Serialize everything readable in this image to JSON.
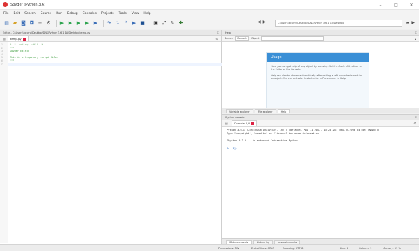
{
  "window": {
    "title": "Spyder (Python 3.6)",
    "controls": {
      "minimize": "–",
      "maximize": "□",
      "close": "✕"
    }
  },
  "menu": [
    "File",
    "Edit",
    "Search",
    "Source",
    "Run",
    "Debug",
    "Consoles",
    "Projects",
    "Tools",
    "View",
    "Help"
  ],
  "toolbar": {
    "path": "C:\\Users\\bcurry\\Desktop\\DNXPython 3.6.1 1A\\Desktop",
    "icons": [
      "new-file",
      "open",
      "save",
      "save-all",
      "files",
      "preferences",
      "run",
      "run-cell",
      "run-cell-advance",
      "run-selection",
      "debug",
      "step",
      "step-into",
      "step-return",
      "continue",
      "stop",
      "maximize-pane",
      "python-path",
      "back",
      "forward"
    ]
  },
  "editor": {
    "title": "Editor - C:\\Users\\bcurry\\Desktop\\DNXPython 3.6.1 1A\\Desktop\\temp.py",
    "tab_label": "temp.py",
    "lines": [
      {
        "n": "1",
        "text": "# -*- coding: utf-8 -*-",
        "kind": "com"
      },
      {
        "n": "2",
        "text": "\"\"\"",
        "kind": "str"
      },
      {
        "n": "3",
        "text": "Spyder Editor",
        "kind": "str"
      },
      {
        "n": "4",
        "text": "",
        "kind": "str"
      },
      {
        "n": "5",
        "text": "This is a temporary script file.",
        "kind": "str"
      },
      {
        "n": "6",
        "text": "\"\"\"",
        "kind": "str"
      },
      {
        "n": "7",
        "text": "",
        "kind": "act"
      }
    ]
  },
  "help": {
    "title": "Help",
    "source_label": "Source",
    "source_value": "Console",
    "object_label": "Object",
    "card_heading": "Usage",
    "card_para1": "Here you can get help of any object by pressing Ctrl+I in front of it, either on the Editor or the Console.",
    "card_para2": "Help can also be shown automatically after writing a left parenthesis next to an object. You can activate this behavior in Preferences > Help.",
    "tabs": [
      "Variable explorer",
      "File explorer",
      "Help"
    ],
    "active_tab": "Help"
  },
  "console": {
    "title": "IPython console",
    "tab_label": "Console 1/A",
    "lines": [
      "Python 3.6.1 |Continuum Analytics, Inc.| (default, May 11 2017, 13:25:24) [MSC v.1900 64 bit (AMD64)]",
      "Type \"copyright\", \"credits\" or \"license\" for more information.",
      "",
      "IPython 5.3.0 -- An enhanced Interactive Python.",
      "",
      "In [1]:"
    ],
    "bottom_tabs": [
      "IPython console",
      "History log",
      "Internal console"
    ],
    "active_bottom_tab": "IPython console"
  },
  "status": {
    "permissions": "Permissions: RW",
    "eol": "End-of-lines: CRLF",
    "encoding": "Encoding: UTF-8",
    "line": "Line: 8",
    "column": "Column: 1",
    "memory": "Memory: 57 %"
  }
}
